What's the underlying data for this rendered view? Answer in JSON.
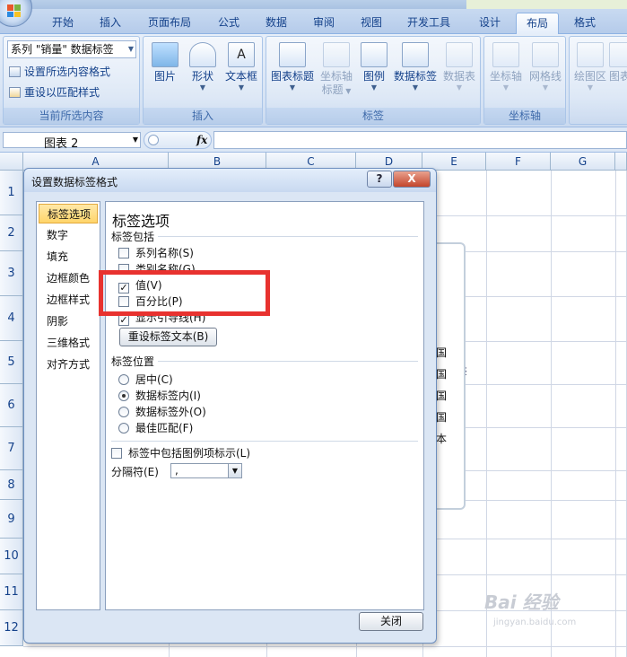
{
  "ribbon_tabs": [
    "开始",
    "插入",
    "页面布局",
    "公式",
    "数据",
    "审阅",
    "视图",
    "开发工具",
    "设计",
    "布局",
    "格式"
  ],
  "active_tab": "布局",
  "current_selection": {
    "dropdown_value": "系列 \"销量\" 数据标签",
    "format_selection": "设置所选内容格式",
    "reset_style": "重设以匹配样式",
    "group_label": "当前所选内容"
  },
  "insert_group": {
    "picture": "图片",
    "shapes": "形状",
    "textbox": "文本框",
    "group_label": "插入"
  },
  "labels_group": {
    "chart_title": "图表标题",
    "axis_title_line1": "坐标轴",
    "axis_title_line2": "标题",
    "legend": "图例",
    "data_labels": "数据标签",
    "data_table": "数据表",
    "group_label": "标签"
  },
  "axes_group": {
    "axes": "坐标轴",
    "gridlines": "网格线",
    "group_label": "坐标轴"
  },
  "extra_group": {
    "plot_area": "绘图区",
    "partial": "图表"
  },
  "formula_bar": {
    "name_box": "图表 2",
    "fx": "fx",
    "formula": ""
  },
  "columns": [
    "A",
    "B",
    "C",
    "D",
    "E",
    "F",
    "G"
  ],
  "rows": [
    "1",
    "2",
    "3",
    "4",
    "5",
    "6",
    "7",
    "8",
    "9",
    "10",
    "11",
    "12"
  ],
  "chart_labels": [
    "国",
    "国",
    "国",
    "国",
    "本"
  ],
  "dialog": {
    "title": "设置数据标签格式",
    "help": "?",
    "close_x": "X",
    "nav": [
      "标签选项",
      "数字",
      "填充",
      "边框颜色",
      "边框样式",
      "阴影",
      "三维格式",
      "对齐方式"
    ],
    "selected_nav": "标签选项",
    "section_title": "标签选项",
    "label_contains_header": "标签包括",
    "options": {
      "series_name": {
        "label": "系列名称(S)",
        "checked": false
      },
      "category_name": {
        "label": "类别名称(G)",
        "checked": false
      },
      "value": {
        "label": "值(V)",
        "checked": true
      },
      "percentage": {
        "label": "百分比(P)",
        "checked": false
      },
      "leader_lines": {
        "label": "显示引导线(H)",
        "checked": true
      }
    },
    "check_mark": "✓",
    "reset_text_button": "重设标签文本(B)",
    "position_header": "标签位置",
    "positions": [
      {
        "label": "居中(C)",
        "selected": false
      },
      {
        "label": "数据标签内(I)",
        "selected": true
      },
      {
        "label": "数据标签外(O)",
        "selected": false
      },
      {
        "label": "最佳匹配(F)",
        "selected": false
      }
    ],
    "legend_key": {
      "label": "标签中包括图例项标示(L)",
      "checked": false
    },
    "separator_label": "分隔符(E)",
    "separator_value": ",",
    "close_button": "关闭"
  },
  "watermark": {
    "text": "Bai 经验",
    "sub": "jingyan.baidu.com"
  },
  "colors": {
    "highlight_box": "#e8322f",
    "selected_nav": "#ffd56a"
  }
}
